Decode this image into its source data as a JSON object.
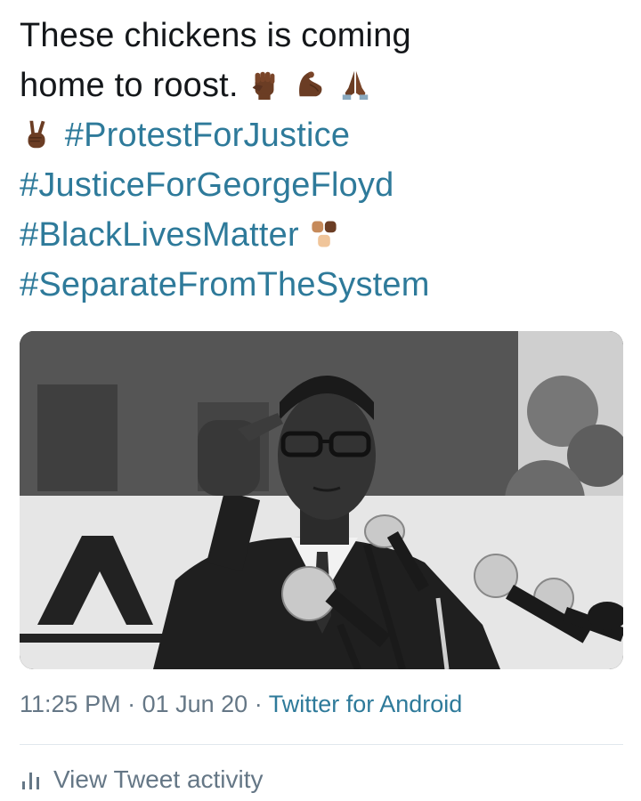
{
  "tweet": {
    "line1": "These chickens is coming",
    "line2": "home to roost.",
    "emoji_line2": [
      "raised-fist-dark-skin",
      "flexed-biceps-dark-skin",
      "folded-hands-dark-skin"
    ],
    "emoji_line3": [
      "victory-hand-dark-skin"
    ],
    "hashtags": {
      "h1": "#ProtestForJustice",
      "h2": "#JusticeForGeorgeFloyd",
      "h3": "#BlackLivesMatter",
      "h4": "#SeparateFromTheSystem"
    },
    "emoji_after_h3": [
      "raised-fists-multiple-skin-tones"
    ],
    "hashtag_color": "#2e7a9a"
  },
  "media": {
    "type": "black-and-white-photo",
    "description_icon": "man-speaking-at-microphones-photo"
  },
  "meta": {
    "time": "11:25 PM",
    "separator": " · ",
    "date": "01 Jun 20",
    "source": "Twitter for Android"
  },
  "activity": {
    "label": "View Tweet activity",
    "icon": "bar-chart-icon"
  }
}
